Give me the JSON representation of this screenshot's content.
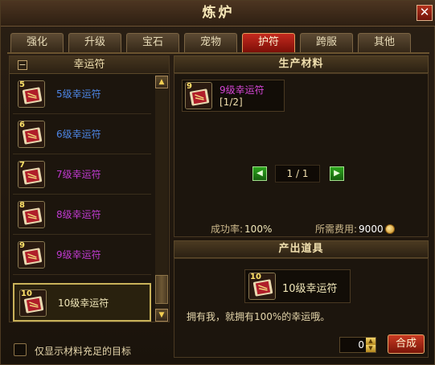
{
  "window": {
    "title": "炼炉",
    "close_label": "✕"
  },
  "tabs": [
    {
      "label": "强化"
    },
    {
      "label": "升级"
    },
    {
      "label": "宝石"
    },
    {
      "label": "宠物"
    },
    {
      "label": "护符",
      "active": true
    },
    {
      "label": "跨服"
    },
    {
      "label": "其他"
    }
  ],
  "left": {
    "header": "幸运符",
    "collapse_symbol": "−",
    "items": [
      {
        "label": "5级幸运符",
        "level": "5",
        "color": "#4d86e6"
      },
      {
        "label": "6级幸运符",
        "level": "6",
        "color": "#4d86e6"
      },
      {
        "label": "7级幸运符",
        "level": "7",
        "color": "#c03ad0"
      },
      {
        "label": "8级幸运符",
        "level": "8",
        "color": "#c03ad0"
      },
      {
        "label": "9级幸运符",
        "level": "9",
        "color": "#c03ad0"
      },
      {
        "label": "10级幸运符",
        "level": "10",
        "color": "#f0e6b8",
        "selected": true
      }
    ],
    "scroll_up": "▲",
    "scroll_down": "▼",
    "filter_label": "仅显示材料充足的目标"
  },
  "materials": {
    "header": "生产材料",
    "item_name": "9级幸运符",
    "item_level": "9",
    "item_count": "[1/2]",
    "prev": "◀",
    "next": "▶",
    "page": "1 / 1",
    "success_label": "成功率:",
    "success_value": "100%",
    "fee_label": "所需费用:",
    "fee_value": "9000"
  },
  "output": {
    "header": "产出道具",
    "item_name": "10级幸运符",
    "item_level": "10",
    "description": "拥有我，就拥有100%的幸运哦。",
    "quantity": "0",
    "compose_label": "合成"
  },
  "colors": {
    "accent_red": "#c52a1f",
    "gold": "#f0dfae",
    "purple": "#d445d4",
    "blue": "#4d86e6"
  }
}
